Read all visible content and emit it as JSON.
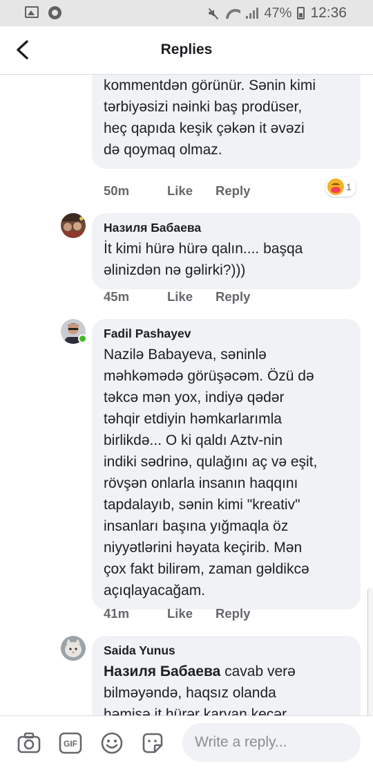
{
  "status_bar": {
    "battery": "47%",
    "time": "12:36"
  },
  "header": {
    "title": "Replies"
  },
  "comments": [
    {
      "author": "",
      "text": "tərbiyən yazdığın bu\nkommentdən görünür. Sənin kimi\ntərbiyəsizi nəinki baş prodüser,\nheç qapıda keşik çəkən it əvəzi\ndə qoymaq olmaz.",
      "time": "50m",
      "like": "Like",
      "reply": "Reply",
      "reaction_count": "1"
    },
    {
      "author": "Назиля Бабаева",
      "text": "İt kimi hürə hürə qalın.... başqa\nəlinizdən nə gəlirki?)))",
      "time": "45m",
      "like": "Like",
      "reply": "Reply"
    },
    {
      "author": "Fadil Pashayev",
      "text": "Nazilə Babayeva, səninlə\nməhkəmədə görüşəcəm. Özü də\ntəkcə mən yox, indiyə qədər\ntəhqir etdiyin həmkarlarımla\nbirlikdə... O ki qaldı Aztv-nin\nindiki sədrinə, qulağını aç və eşit,\nrövşən onlarla insanın haqqını\ntapdalayıb, sənin kimi \"kreativ\"\ninsanları başına yığmaqla öz\nniyyətlərini həyata keçirib. Mən\nçox fakt bilirəm, zaman gəldikcə\naçıqlayacağam.",
      "time": "41m",
      "like": "Like",
      "reply": "Reply"
    },
    {
      "author": "Saida Yunus",
      "mention": "Назиля Бабаева",
      "text": " cavab verə\nbilməyəndə, haqsız olanda\nhəmişə it hürər karvan keçər"
    }
  ],
  "composer": {
    "placeholder": "Write a reply..."
  },
  "colors": {
    "bubble": "#f0f2f5",
    "meta": "#65676b",
    "online": "#42b72a"
  }
}
